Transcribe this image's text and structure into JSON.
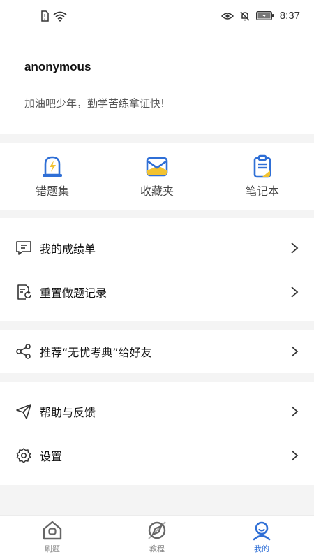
{
  "status_bar": {
    "time": "8:37",
    "icons": [
      "sim-alert-icon",
      "wifi-icon",
      "eye-icon",
      "mute-icon",
      "battery-icon"
    ]
  },
  "profile": {
    "username": "anonymous",
    "motto": "加油吧少年，勤学苦练拿证快!"
  },
  "quick_actions": [
    {
      "label": "错题集",
      "icon": "wrong-questions-icon"
    },
    {
      "label": "收藏夹",
      "icon": "favorites-icon"
    },
    {
      "label": "笔记本",
      "icon": "notebook-icon"
    }
  ],
  "menu": {
    "group1": [
      {
        "label": "我的成绩单",
        "icon": "report-card-icon"
      },
      {
        "label": "重置做题记录",
        "icon": "reset-record-icon"
      }
    ],
    "group2": [
      {
        "label": "推荐“无忧考典”给好友",
        "icon": "share-icon"
      }
    ],
    "group3": [
      {
        "label": "帮助与反馈",
        "icon": "paper-plane-icon"
      },
      {
        "label": "设置",
        "icon": "settings-gear-icon"
      }
    ]
  },
  "tabbar": {
    "tabs": [
      {
        "label": "刷题",
        "icon": "home-icon",
        "active": false
      },
      {
        "label": "教程",
        "icon": "compass-icon",
        "active": false
      },
      {
        "label": "我的",
        "icon": "profile-icon",
        "active": true
      }
    ]
  },
  "colors": {
    "accent": "#2f6fd6",
    "highlight": "#f2c230",
    "background": "#f4f4f4"
  }
}
